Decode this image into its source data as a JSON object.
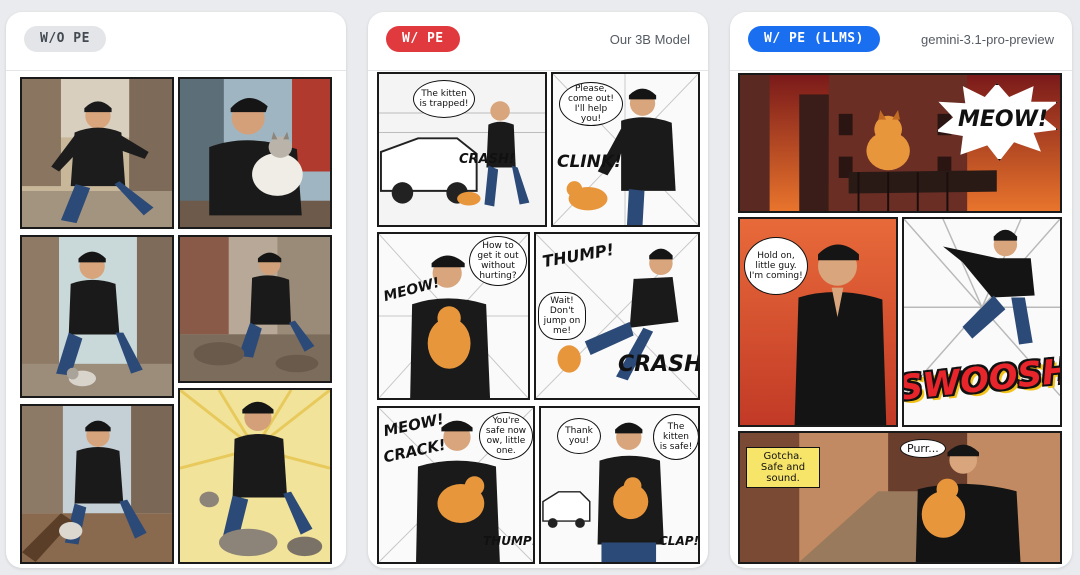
{
  "columns": [
    {
      "badge": "W/O PE",
      "badge_bg": "#e3e5e8",
      "badge_color": "#444a52",
      "model": ""
    },
    {
      "badge": "W/ PE",
      "badge_bg": "#e03a3e",
      "badge_color": "#ffffff",
      "model": "Our 3B Model"
    },
    {
      "badge": "W/ PE (LLMS)",
      "badge_bg": "#1a6ff0",
      "badge_color": "#ffffff",
      "model": "gemini-3.1-pro-preview"
    }
  ],
  "col2": {
    "p1_bubble": "The kitten is trapped!",
    "p1_sfx": "CRASH!",
    "p2_bubble": "Please, come out! I'll help you!",
    "p2_sfx": "CLINK!",
    "p3_bubble": "How to get it out without hurting?",
    "p3_sfx": "MEOW!",
    "p4_sfx1": "THUMP!",
    "p4_bubble": "Wait! Don't jump on me!",
    "p4_sfx2": "CRASH!",
    "p5_sfx1": "MEOW!",
    "p5_sfx2": "CRACK!",
    "p5_bubble": "You're safe now ow, little one.",
    "p5_sfx3": "THUMP!",
    "p6_bubble1": "Thank you!",
    "p6_bubble2": "The kitten is safe!",
    "p6_sfx": "CLAP!"
  },
  "col3": {
    "p1_sfx": "MEOW!",
    "p2_bubble": "Hold on, little guy. I'm coming!",
    "p3_sfx": "SWOOSH!",
    "p4_caption": "Gotcha. Safe and sound.",
    "p4_sfx": "Purr..."
  }
}
